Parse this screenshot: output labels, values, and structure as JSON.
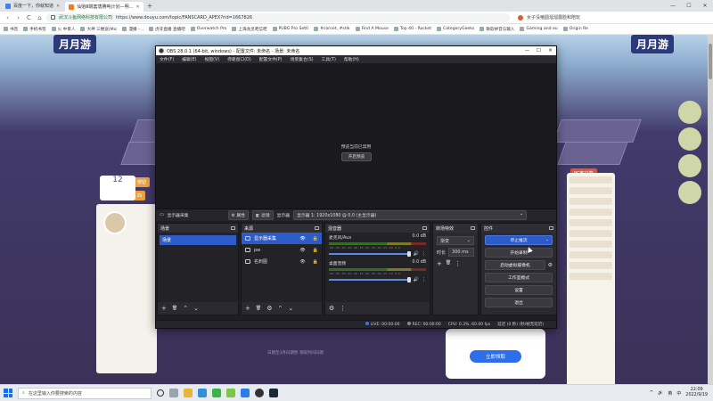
{
  "browser": {
    "tabs": [
      {
        "label": "百度一下，你就知道",
        "active": false
      },
      {
        "label": "仙贻Ⅲ端套唐腾吨计划—明...",
        "active": true
      }
    ],
    "new_tab": "+",
    "window_controls": [
      "—",
      "☐",
      "✕"
    ],
    "nav": {
      "back": "‹",
      "forward": "›",
      "reload": "C",
      "home": "⌂"
    },
    "address": {
      "site_label": "武汉斗鱼网络科技有限公司",
      "url": "https://www.douyu.com/topic/FANSCARD_APEX?rid=1667826"
    },
    "address_right": {
      "search_hint": "女子没嗑圆溜溜露脸和陪玩"
    },
    "bookmarks": [
      "书签",
      "手机书签",
      "火 中育人",
      "大神 三楼途(Mic",
      "漫播 -...",
      "虎牙直播 直播吧",
      "Overwatch Pro",
      "上海龙灵吧信吧",
      "PUBG Pro Setti",
      "#cornet, #stik",
      "Find A Mouse",
      "Top 40 - Rocket",
      "CategoryGeeks",
      "微软拼音与输入",
      "Gaming and eu",
      "Origin Re"
    ]
  },
  "page": {
    "hero_left": "月月游",
    "hero_right": "月月游",
    "stat_number": "12",
    "side_chip": "PC客户端",
    "login_button": "立即领取",
    "footer": "日期至3月日期暂 领取时间日期",
    "left_buttons": [
      "按钮",
      "四"
    ]
  },
  "obs": {
    "title": "OBS 28.0.1 (64-bit, windows) - 配置文件: 未命名 - 场景: 未命名",
    "menu": [
      "文件(F)",
      "编辑(E)",
      "视图(V)",
      "停靠窗口(D)",
      "配置文件(P)",
      "场景集合(S)",
      "工具(T)",
      "帮助(H)"
    ],
    "preview": {
      "message": "预览当前已禁用",
      "button": "开启预览"
    },
    "source_bar": {
      "source_name": "显示器采集",
      "properties": "属性",
      "filters": "滤镜",
      "display_label": "显示器",
      "display_value": "显示器 1: 1920x1080 @ 0,0 (主显示器)"
    },
    "scenes": {
      "title": "场景",
      "items": [
        "场景"
      ]
    },
    "sources": {
      "title": "来源",
      "items": [
        {
          "name": "显示器采集",
          "selected": true,
          "eye": "👁",
          "lock": "🔒"
        },
        {
          "name": "pw",
          "selected": false,
          "eye": "👁",
          "lock": "🔒"
        },
        {
          "name": "名刺图",
          "selected": false,
          "eye": "👁",
          "lock": "🔒"
        }
      ]
    },
    "mixer": {
      "title": "混音器",
      "tracks": [
        {
          "name": "麦克风/Aux",
          "level": "0.0 dB",
          "ticks": "-60 -55 -50 -45 -40 -35 -30 -25 -20 -15 -10 -5 0"
        },
        {
          "name": "桌面音频",
          "level": "0.0 dB",
          "ticks": "-60 -55 -50 -45 -40 -35 -30 -25 -20 -15 -10 -5 0"
        }
      ]
    },
    "transitions": {
      "title": "转场特效",
      "type": "渐变",
      "duration_label": "时长",
      "duration_value": "300 ms"
    },
    "controls": {
      "title": "控件",
      "buttons": [
        "停止推流",
        "开始录制",
        "启动虚拟摄像机",
        "工作室模式",
        "设置",
        "退出"
      ]
    },
    "status": {
      "live": "LIVE: 00:00:00",
      "rec": "REC: 00:00:00",
      "cpu": "CPU: 0.3%, 60.00 fps",
      "delay": "延迟 (0 秒) (秒/帧无延迟)"
    },
    "footer_icons": {
      "add": "+",
      "remove": "🗑",
      "gear": "⚙",
      "up": "⌃",
      "down": "⌄",
      "more": "⋮"
    }
  },
  "taskbar": {
    "search_placeholder": "在这里输入你要搜索的内容",
    "time": "22:09",
    "date": "2022/9/19",
    "lang": "中",
    "tray_icons": [
      "^",
      "🔊",
      "英"
    ]
  }
}
